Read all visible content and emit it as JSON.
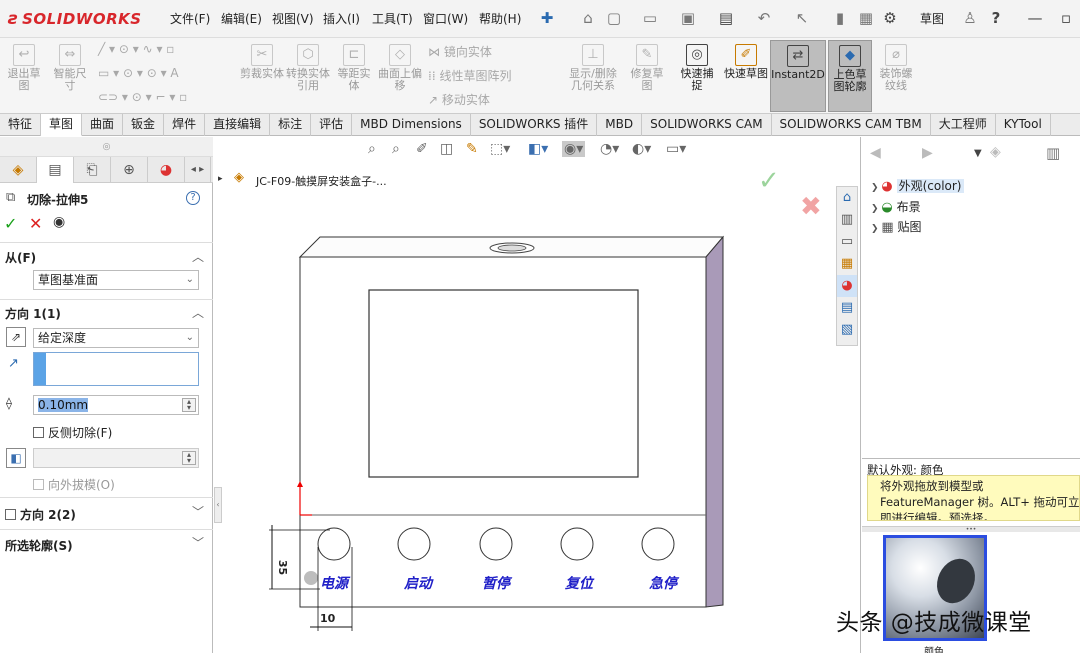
{
  "brand": {
    "logo_prefix": "3S",
    "logo_text": "SOLIDWORKS"
  },
  "menus": [
    "文件(F)",
    "编辑(E)",
    "视图(V)",
    "插入(I)",
    "工具(T)",
    "窗口(W)",
    "帮助(H)"
  ],
  "top_search_text": "草图",
  "ribbon": {
    "exit_sketch": "退出草图",
    "smart_dim": "智能尺寸",
    "trim": "剪裁实体",
    "convert": "转换实体引用",
    "offset": "等距实体",
    "offset_surface": "曲面上偏移",
    "mirror": "镜向实体",
    "linear_pattern": "线性草图阵列",
    "move": "移动实体",
    "display_delete_rel": "显示/删除几何关系",
    "repair": "修复草图",
    "quick_snap": "快速捕捉",
    "rapid_sketch": "快速草图",
    "instant2d": "Instant2D",
    "shaded_sketch": "上色草图轮廓",
    "cosmetic_thread": "装饰螺纹线"
  },
  "tabs": [
    "特征",
    "草图",
    "曲面",
    "钣金",
    "焊件",
    "直接编辑",
    "标注",
    "评估",
    "MBD Dimensions",
    "SOLIDWORKS 插件",
    "MBD",
    "SOLIDWORKS CAM",
    "SOLIDWORKS CAM TBM",
    "大工程师",
    "KYTool"
  ],
  "active_tab": "草图",
  "property_manager": {
    "title": "切除-拉伸5",
    "from_label": "从(F)",
    "from_value": "草图基准面",
    "dir1_label": "方向 1(1)",
    "end_condition": "给定深度",
    "depth": "0.10mm",
    "flip_side": "反侧切除(F)",
    "draft_outward": "向外拔模(O)",
    "dir2_label": "方向 2(2)",
    "selected_contours": "所选轮廓(S)"
  },
  "breadcrumb": "JC-F09-触摸屏安装盒子-...",
  "model": {
    "buttons": [
      "电源",
      "启动",
      "暂停",
      "复位",
      "急停"
    ],
    "dim_35": "35",
    "dim_10": "10"
  },
  "task_pane": {
    "tree": [
      "外观(color)",
      "布景",
      "贴图"
    ],
    "default_appearance": "默认外观: 颜色",
    "tip": "将外观拖放到模型或 FeatureManager 树。ALT+ 拖动可立即进行编辑。预选择。",
    "swatch_label": "颜色"
  },
  "watermark": "头条 @技成微课堂"
}
